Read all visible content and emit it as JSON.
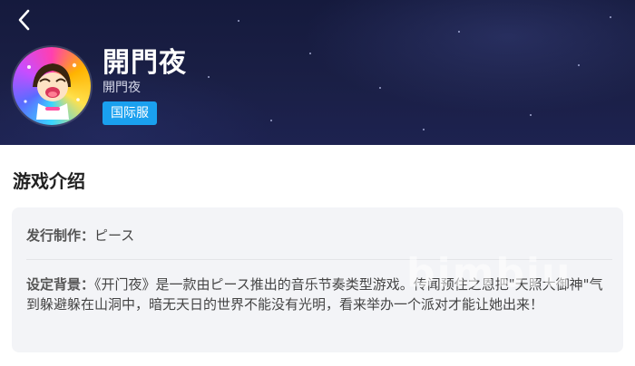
{
  "header": {
    "back_icon": "chevron-left-icon",
    "title": "開門夜",
    "subtitle": "開門夜",
    "server_badge": "国际服",
    "badge_color": "#1aa0ef",
    "background_color": "#1a1f45"
  },
  "intro": {
    "section_title": "游戏介绍",
    "publisher_label": "发行制作：",
    "publisher_value": "ピース",
    "background_label": "设定背景：",
    "background_text": "《开门夜》是一款由ピース推出的音乐节奏类型游戏。传闻预住之恩把\"天照大御神\"气到躲避躲在山洞中，暗无天日的世界不能没有光明，看来举办一个派对才能让她出来！"
  },
  "watermark": "bimbiu"
}
